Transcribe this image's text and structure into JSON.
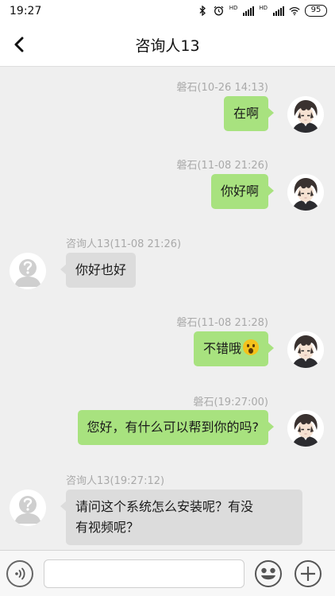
{
  "status_bar": {
    "time": "19:27",
    "hd1": "HD",
    "hd2": "HD",
    "battery": "95",
    "icons": [
      "bluetooth-icon",
      "alarm-icon",
      "signal-icon",
      "signal-icon",
      "wifi-icon",
      "battery-icon"
    ]
  },
  "header": {
    "back_icon": "back-arrow-icon",
    "title": "咨询人13"
  },
  "messages": [
    {
      "side": "right",
      "meta": "磐石(10-26 14:13)",
      "text": "在啊"
    },
    {
      "side": "right",
      "meta": "磐石(11-08 21:26)",
      "text": "你好啊"
    },
    {
      "side": "left",
      "meta": "咨询人13(11-08 21:26)",
      "text": "你好也好"
    },
    {
      "side": "right",
      "meta": "磐石(11-08 21:28)",
      "text": "不错哦",
      "emoji": "astonished-face-emoji"
    },
    {
      "side": "right",
      "meta": "磐石(19:27:00)",
      "text": "您好，有什么可以帮到你的吗?"
    },
    {
      "side": "left",
      "meta": "咨询人13(19:27:12)",
      "text_line1": "请问这个系统怎么安装呢？有没",
      "text_line2": "有视频呢？"
    }
  ],
  "input_bar": {
    "input_value": "",
    "voice_icon": "voice-icon",
    "emoji_icon": "emoji-icon",
    "plus_icon": "plus-icon"
  },
  "colors": {
    "outgoing_bubble": "#a8e27f",
    "incoming_bubble": "#dcdcdc",
    "chat_background": "#efefef"
  }
}
